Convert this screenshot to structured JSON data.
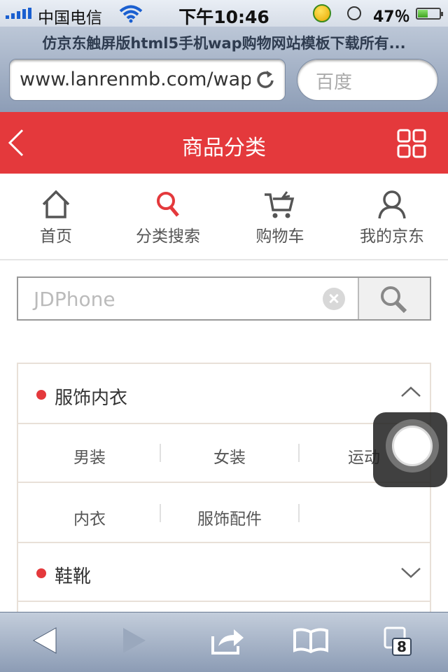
{
  "status_bar": {
    "carrier": "中国电信",
    "time": "下午10:46",
    "battery": "47％",
    "battery_level": 0.47
  },
  "browser": {
    "page_title": "仿京东触屏版html5手机wap购物网站模板下载所有...",
    "url": "www.lanrenmb.com/wap",
    "search_placeholder": "百度",
    "tabs_count": "8"
  },
  "header": {
    "title": "商品分类"
  },
  "nav": {
    "items": [
      {
        "label": "首页",
        "icon": "home-icon"
      },
      {
        "label": "分类搜索",
        "icon": "search-icon"
      },
      {
        "label": "购物车",
        "icon": "cart-icon"
      },
      {
        "label": "我的京东",
        "icon": "user-icon"
      }
    ]
  },
  "search": {
    "placeholder": "JDPhone"
  },
  "categories": [
    {
      "name": "服饰内衣",
      "expanded": true,
      "subs": [
        "男装",
        "女装",
        "运动",
        "内衣",
        "服饰配件"
      ]
    },
    {
      "name": "鞋靴",
      "expanded": false
    }
  ],
  "colors": {
    "brand_red": "#e4393c"
  }
}
